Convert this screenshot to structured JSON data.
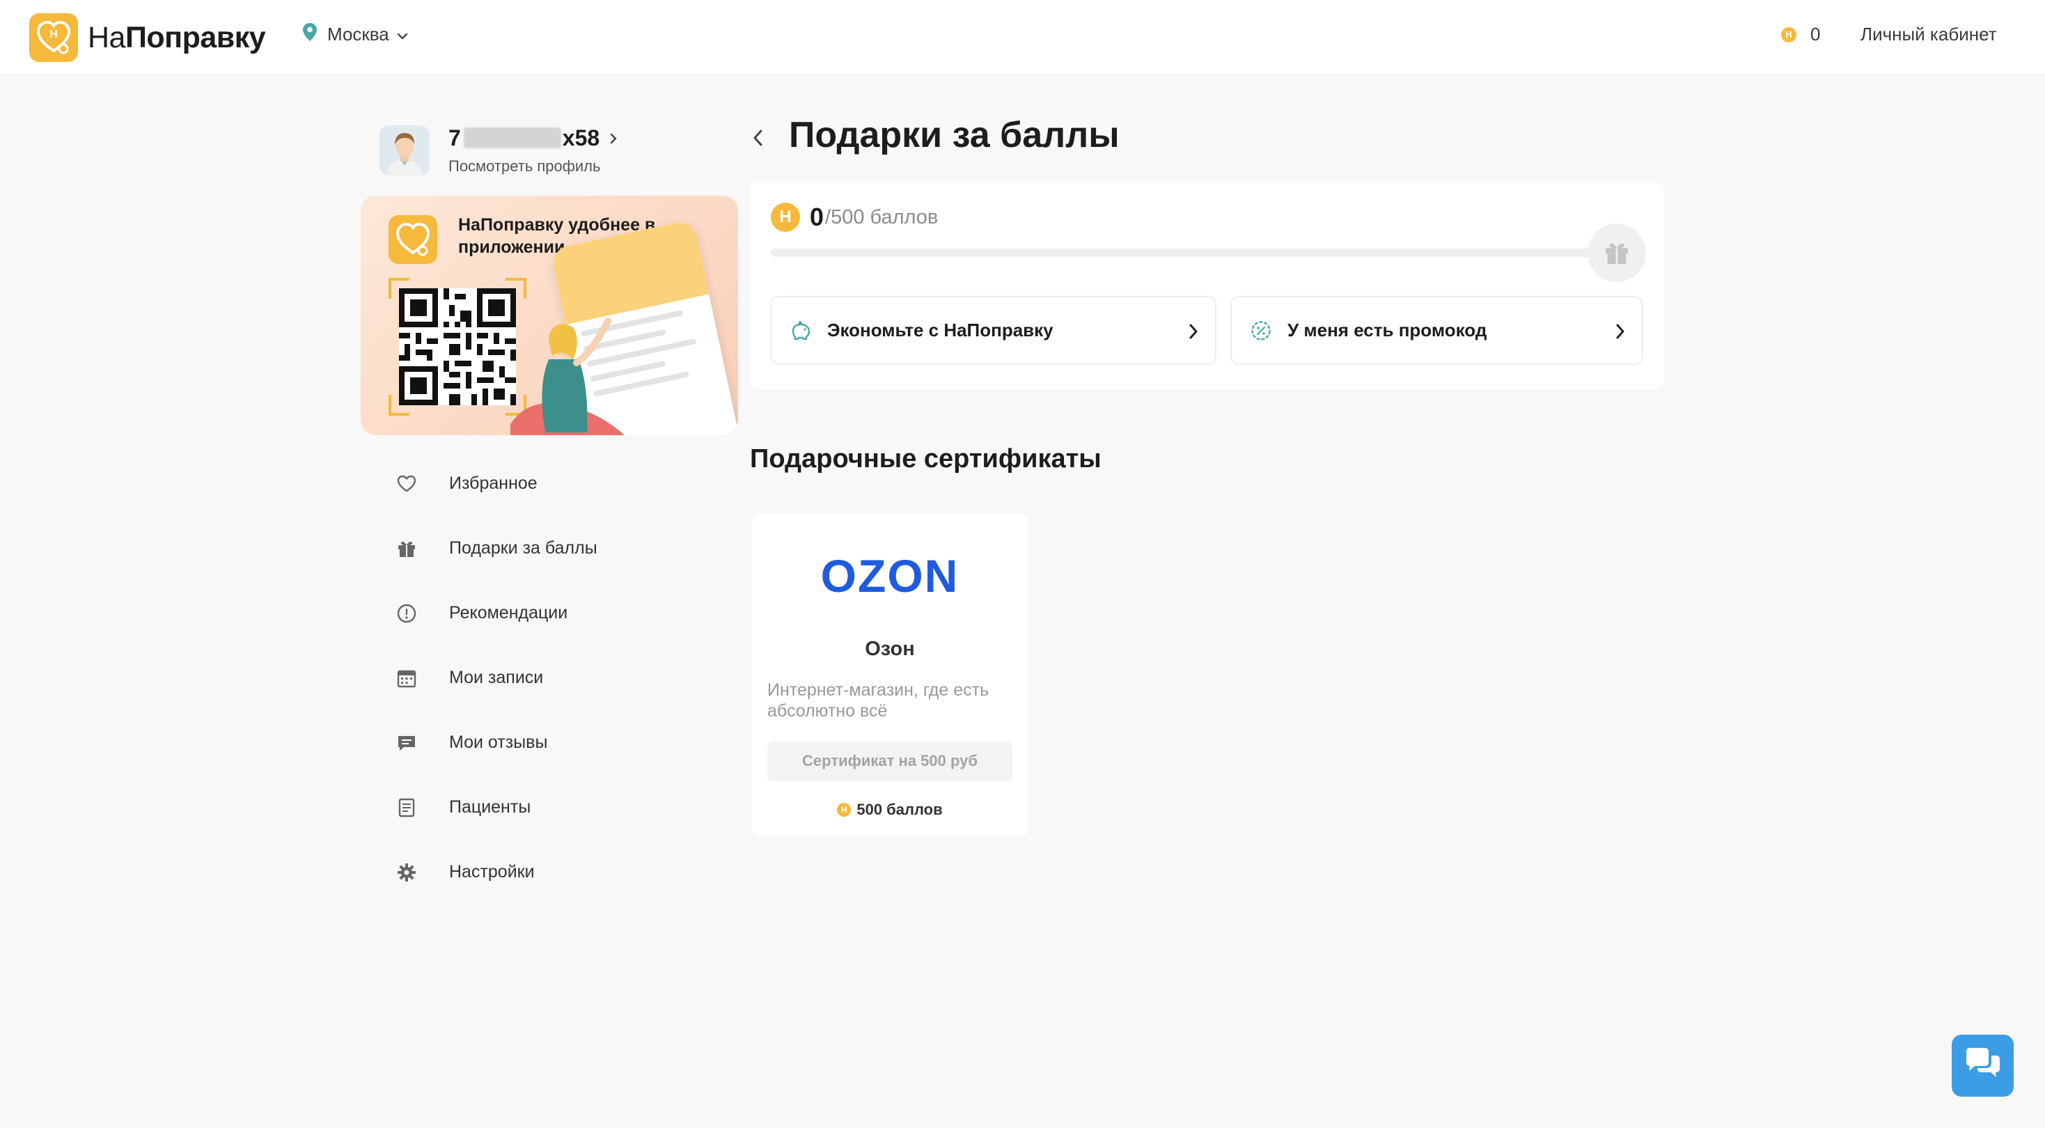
{
  "header": {
    "logo_part1": "На",
    "logo_part2": "Поправку",
    "logo_badge_letter": "Н",
    "city": "Москва",
    "points_badge": "Н",
    "points_value": "0",
    "cabinet_link": "Личный кабинет"
  },
  "profile": {
    "name_prefix": "7",
    "name_suffix": "x58",
    "view_link": "Посмотреть профиль"
  },
  "app_promo": {
    "title": "НаПоправку удобнее в приложении"
  },
  "menu": {
    "items": [
      {
        "label": "Избранное",
        "icon": "heart-icon"
      },
      {
        "label": "Подарки за баллы",
        "icon": "gift-icon"
      },
      {
        "label": "Рекомендации",
        "icon": "alert-circle-icon"
      },
      {
        "label": "Мои записи",
        "icon": "calendar-icon"
      },
      {
        "label": "Мои отзывы",
        "icon": "comment-icon"
      },
      {
        "label": "Пациенты",
        "icon": "document-icon"
      },
      {
        "label": "Настройки",
        "icon": "gear-icon"
      }
    ]
  },
  "main": {
    "title": "Подарки за баллы",
    "points": {
      "badge": "Н",
      "current": "0",
      "total_text": "/500 баллов",
      "progress_fraction": 0
    },
    "actions": [
      {
        "label": "Экономьте с НаПоправку",
        "icon": "piggy-bank-icon"
      },
      {
        "label": "У меня есть промокод",
        "icon": "percent-badge-icon"
      }
    ],
    "section_title": "Подарочные сертификаты",
    "gifts": [
      {
        "logo": "OZON",
        "name": "Озон",
        "description": "Интернет-магазин, где есть абсолютно всё",
        "certificate": "Сертификат на 500 руб",
        "badge": "Н",
        "price": "500 баллов"
      }
    ]
  },
  "colors": {
    "accent": "#f6b93b",
    "ozon_blue": "#1f5bde",
    "chat_blue": "#3b9de5",
    "pin": "#4aa7a6"
  }
}
